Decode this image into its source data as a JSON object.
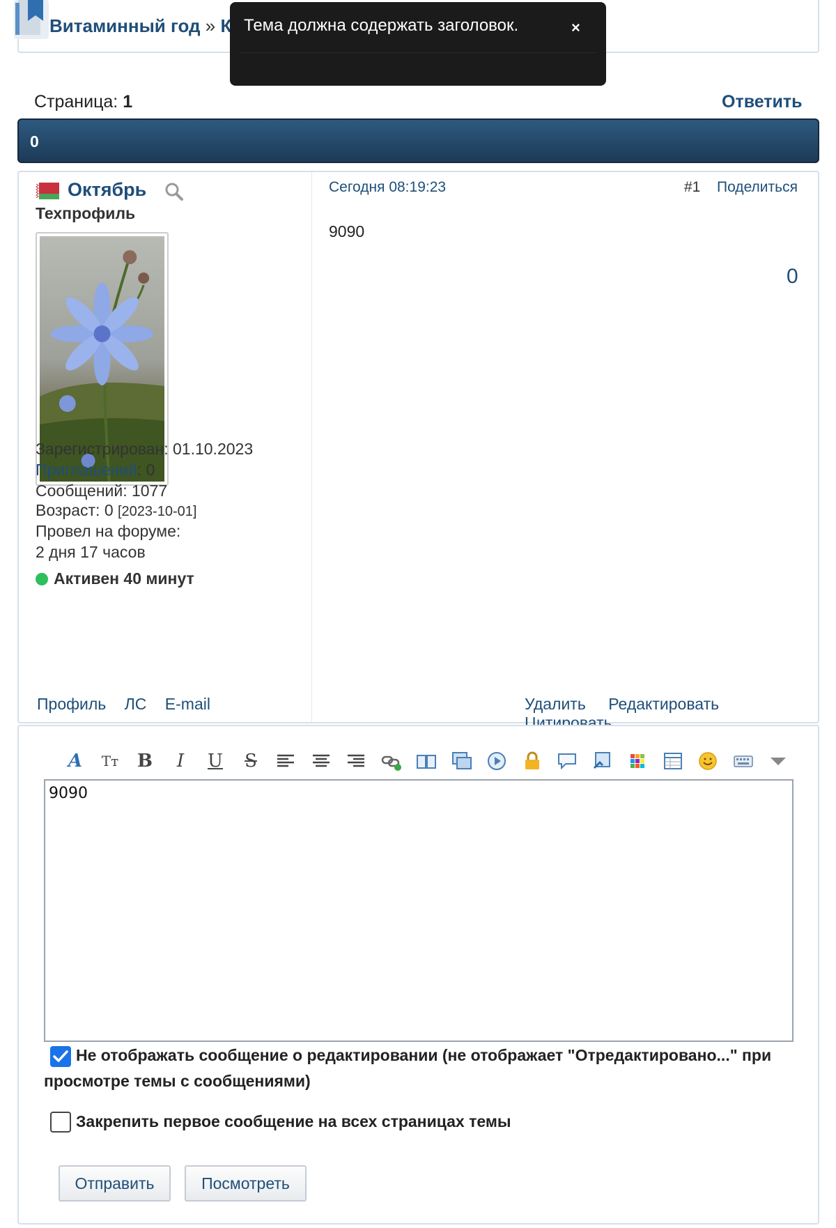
{
  "breadcrumb": {
    "forum": "Витаминный год",
    "separator": "»",
    "partial": "Кор"
  },
  "toast": {
    "message": "Тема должна содержать заголовок.",
    "close": "×"
  },
  "pager": {
    "label": "Страница:",
    "current": "1"
  },
  "reply_label": "Ответить",
  "topic": {
    "title": "0"
  },
  "post": {
    "author": "Октябрь",
    "rank": "Техпрофиль",
    "registered": "Зарегистрирован: 01.10.2023",
    "invites_label": "Приглашений",
    "invites_value": ": 0",
    "messages": "Сообщений: 1077",
    "age": "Возраст: 0",
    "age_date": "[2023-10-01]",
    "time_label": "Провел на форуме:",
    "time_value": "2 дня 17 часов",
    "online": "Активен 40 минут",
    "links": {
      "profile": "Профиль",
      "pm": "ЛС",
      "email": "E-mail"
    },
    "date": "Сегодня 08:19:23",
    "number": "#1",
    "share": "Поделиться",
    "body": "9090",
    "count": "0",
    "actions": {
      "delete": "Удалить",
      "edit": "Редактировать",
      "quote": "Цитировать"
    },
    "flag_colors": {
      "red": "#c8313e",
      "green": "#4aa657"
    }
  },
  "editor": {
    "text": "9090",
    "toolbar": {
      "font": "A",
      "size": "Tт",
      "bold": "B",
      "italic": "I",
      "underline": "U",
      "strike": "S"
    },
    "opt_no_edit_notice": "Не отображать сообщение о редактировании (не отображает \"Отредактировано...\" при просмотре темы с сообщениями)",
    "opt_pin_first": "Закрепить первое сообщение на всех страницах темы",
    "submit": "Отправить",
    "preview": "Посмотреть"
  },
  "colors": {
    "accent": "#1f4e79",
    "header_bar": "#1c3a57",
    "online": "#2ebf5c",
    "checkbox": "#1a73e8"
  }
}
